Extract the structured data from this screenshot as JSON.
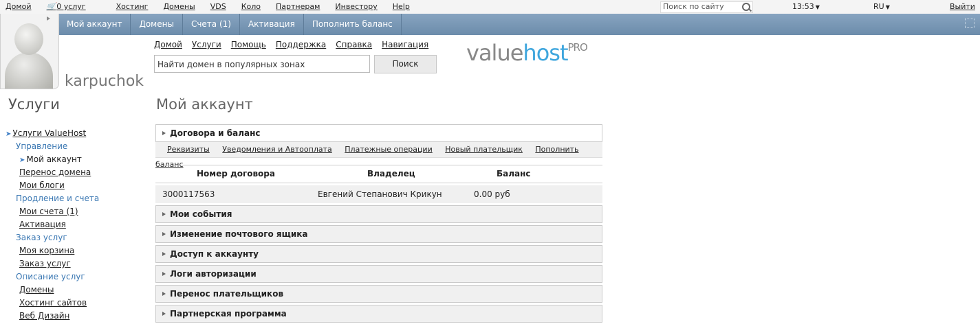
{
  "topbar": {
    "links": [
      "Домой",
      "0 услуг",
      "Хостинг",
      "Домены",
      "VDS",
      "Коло",
      "Партнерам",
      "Инвестору",
      "Help"
    ],
    "search_placeholder": "Поиск по сайту",
    "time": "13:53",
    "lang": "RU",
    "logout": "Выйти"
  },
  "menu": [
    "Мой аккаунт",
    "Домены",
    "Счета (1)",
    "Активация",
    "Пополнить баланс"
  ],
  "user": {
    "name": "karpuchok"
  },
  "subnav": [
    "Домой",
    "Услуги",
    "Помощь",
    "Поддержка",
    "Справка",
    "Навигация"
  ],
  "domain_search": {
    "value": "Найти домен в популярных зонах",
    "button": "Поиск"
  },
  "logo": {
    "part1": "value",
    "part2": "host",
    "sup": "PRO"
  },
  "sidebar": {
    "title": "Услуги",
    "root": "Услуги ValueHost",
    "items": [
      {
        "type": "group",
        "label": "Управление"
      },
      {
        "type": "current",
        "label": "Мой аккаунт"
      },
      {
        "type": "link",
        "label": "Перенос домена"
      },
      {
        "type": "link",
        "label": "Мои блоги"
      },
      {
        "type": "group",
        "label": "Продление и счета"
      },
      {
        "type": "link",
        "label": "Мои счета (1)"
      },
      {
        "type": "link",
        "label": "Активация"
      },
      {
        "type": "group",
        "label": "Заказ услуг"
      },
      {
        "type": "link",
        "label": "Моя корзина"
      },
      {
        "type": "link",
        "label": "Заказ услуг"
      },
      {
        "type": "group",
        "label": "Описание услуг"
      },
      {
        "type": "link",
        "label": "Домены"
      },
      {
        "type": "link",
        "label": "Хостинг сайтов"
      },
      {
        "type": "link",
        "label": "Веб Дизайн"
      }
    ]
  },
  "main": {
    "title": "Мой аккаунт",
    "contracts_panel": "Договора и баланс",
    "tabs": [
      "Реквизиты",
      "Уведомления и Автооплата",
      "Платежные операции",
      "Новый плательщик",
      "Пополнить баланс"
    ],
    "table": {
      "headers": [
        "Номер договора",
        "Владелец",
        "Баланс"
      ],
      "row": [
        "3000117563",
        "Евгений Степанович Крикун",
        "0.00 руб"
      ]
    },
    "panels": [
      "Мои события",
      "Изменение почтового ящика",
      "Доступ к аккаунту",
      "Логи авторизации",
      "Перенос плательщиков",
      "Партнерская программа"
    ]
  }
}
